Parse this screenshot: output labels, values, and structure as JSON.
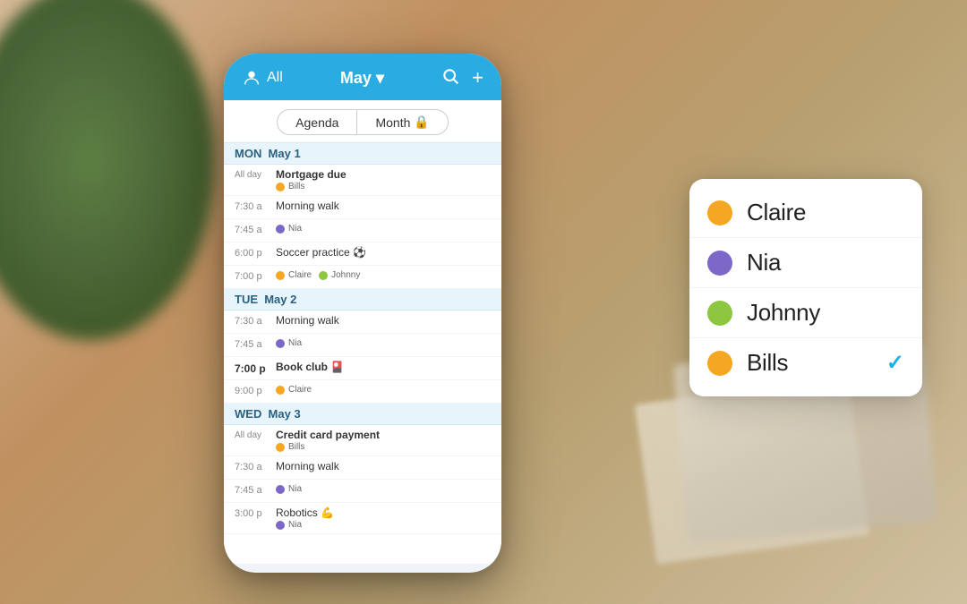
{
  "background": {
    "gradient_start": "#c8a882",
    "gradient_end": "#b08050"
  },
  "phone": {
    "header": {
      "user_label": "All",
      "month_label": "May ▾",
      "search_icon": "🔍",
      "add_icon": "+"
    },
    "view_toggle": {
      "agenda_label": "Agenda",
      "month_label": "Month",
      "lock_icon": "🔒"
    },
    "agenda": {
      "days": [
        {
          "day_label": "MON",
          "date_label": "May 1",
          "events": [
            {
              "time": "All day",
              "time_bold": false,
              "title": "Mortgage due",
              "title_bold": true,
              "calendars": [
                {
                  "color": "#f5a623",
                  "label": "Bills"
                }
              ]
            },
            {
              "time": "7:30 a",
              "time_bold": false,
              "title": "Morning walk",
              "title_bold": false,
              "calendars": []
            },
            {
              "time": "7:45 a",
              "time_bold": false,
              "title": "",
              "title_bold": false,
              "calendars": [
                {
                  "color": "#7b68c8",
                  "label": "Nia"
                }
              ]
            },
            {
              "time": "6:00 p",
              "time_bold": false,
              "title": "Soccer practice ⚽",
              "title_bold": false,
              "calendars": []
            },
            {
              "time": "7:00 p",
              "time_bold": false,
              "title": "",
              "title_bold": false,
              "calendars": [
                {
                  "color": "#f5a623",
                  "label": "Claire"
                },
                {
                  "color": "#8dc63f",
                  "label": "Johnny"
                }
              ]
            }
          ]
        },
        {
          "day_label": "TUE",
          "date_label": "May 2",
          "events": [
            {
              "time": "7:30 a",
              "time_bold": false,
              "title": "Morning walk",
              "title_bold": false,
              "calendars": []
            },
            {
              "time": "7:45 a",
              "time_bold": false,
              "title": "",
              "title_bold": false,
              "calendars": [
                {
                  "color": "#7b68c8",
                  "label": "Nia"
                }
              ]
            },
            {
              "time": "7:00 p",
              "time_bold": true,
              "title": "Book club 🎴",
              "title_bold": true,
              "calendars": []
            },
            {
              "time": "9:00 p",
              "time_bold": false,
              "title": "",
              "title_bold": false,
              "calendars": [
                {
                  "color": "#f5a623",
                  "label": "Claire"
                }
              ]
            }
          ]
        },
        {
          "day_label": "WED",
          "date_label": "May 3",
          "events": [
            {
              "time": "All day",
              "time_bold": false,
              "title": "Credit card payment",
              "title_bold": true,
              "calendars": [
                {
                  "color": "#f5a623",
                  "label": "Bills"
                }
              ]
            },
            {
              "time": "7:30 a",
              "time_bold": false,
              "title": "Morning walk",
              "title_bold": false,
              "calendars": []
            },
            {
              "time": "7:45 a",
              "time_bold": false,
              "title": "",
              "title_bold": false,
              "calendars": [
                {
                  "color": "#7b68c8",
                  "label": "Nia"
                }
              ]
            },
            {
              "time": "3:00 p",
              "time_bold": false,
              "title": "Robotics 💪",
              "title_bold": false,
              "calendars": [
                {
                  "color": "#7b68c8",
                  "label": "Nia"
                }
              ]
            }
          ]
        }
      ]
    }
  },
  "dropdown": {
    "items": [
      {
        "name": "Claire",
        "color": "#f5a623",
        "checked": false
      },
      {
        "name": "Nia",
        "color": "#7b68c8",
        "checked": false
      },
      {
        "name": "Johnny",
        "color": "#8dc63f",
        "checked": false
      },
      {
        "name": "Bills",
        "color": "#f5a623",
        "checked": true
      }
    ],
    "check_mark": "✓"
  }
}
